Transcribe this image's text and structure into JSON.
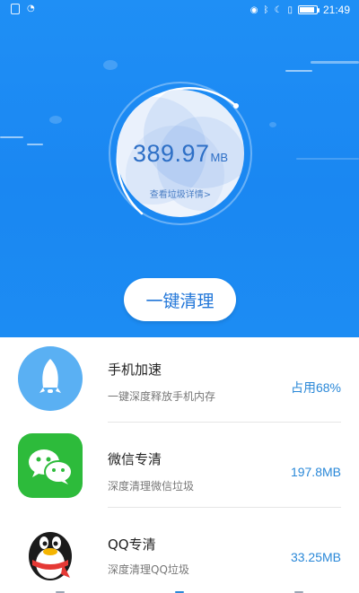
{
  "status_bar": {
    "time": "21:49",
    "icons_left": [
      "sim-icon",
      "wifi-icon"
    ],
    "icons_right": [
      "eye-icon",
      "bluetooth-icon",
      "moon-icon",
      "vibrate-icon",
      "battery-icon"
    ]
  },
  "hero": {
    "storage_value": "389.97",
    "storage_unit": "MB",
    "detail_link": "查看垃圾详情>",
    "clean_button": "一键清理",
    "colors": {
      "background": "#1a87f2",
      "ring": "#ffffff",
      "accent": "#2d6fc6"
    }
  },
  "list": {
    "items": [
      {
        "title": "手机加速",
        "subtitle": "一键深度释放手机内存",
        "metric": "占用68%",
        "icon": "rocket-icon"
      },
      {
        "title": "微信专清",
        "subtitle": "深度清理微信垃圾",
        "metric": "197.8MB",
        "icon": "wechat-icon"
      },
      {
        "title": "QQ专清",
        "subtitle": "深度清理QQ垃圾",
        "metric": "33.25MB",
        "icon": "qq-penguin-icon"
      }
    ]
  }
}
